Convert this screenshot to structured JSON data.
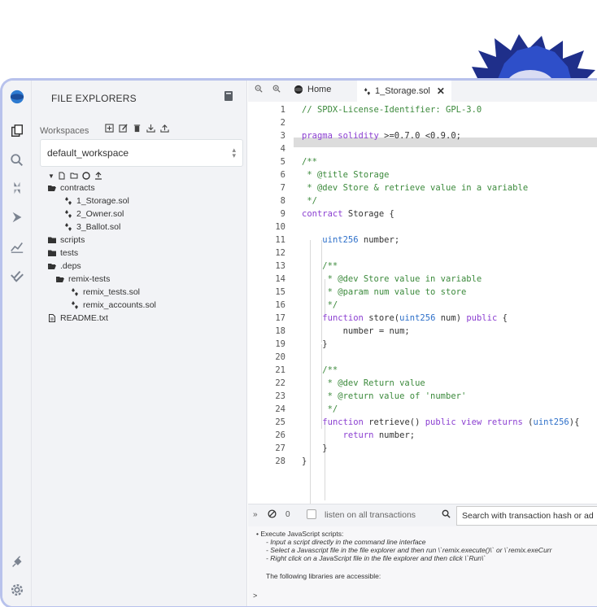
{
  "sidepanel": {
    "title": "FILE EXPLORERS",
    "workspaces_label": "Workspaces",
    "workspace_selected": "default_workspace",
    "tree": [
      {
        "label": "contracts",
        "kind": "folder-open"
      },
      {
        "label": "1_Storage.sol",
        "kind": "sol"
      },
      {
        "label": "2_Owner.sol",
        "kind": "sol"
      },
      {
        "label": "3_Ballot.sol",
        "kind": "sol"
      },
      {
        "label": "scripts",
        "kind": "folder"
      },
      {
        "label": "tests",
        "kind": "folder"
      },
      {
        "label": ".deps",
        "kind": "folder-open"
      },
      {
        "label": "remix-tests",
        "kind": "folder-open"
      },
      {
        "label": "remix_tests.sol",
        "kind": "sol"
      },
      {
        "label": "remix_accounts.sol",
        "kind": "sol"
      },
      {
        "label": "README.txt",
        "kind": "file"
      }
    ]
  },
  "tabs": {
    "home": "Home",
    "active": "1_Storage.sol"
  },
  "editor": {
    "lines": [
      "// SPDX-License-Identifier: GPL-3.0",
      "",
      "pragma solidity >=0.7.0 <0.9.0;",
      "",
      "/**",
      " * @title Storage",
      " * @dev Store & retrieve value in a variable",
      " */",
      "contract Storage {",
      "",
      "    uint256 number;",
      "",
      "    /**",
      "     * @dev Store value in variable",
      "     * @param num value to store",
      "     */",
      "    function store(uint256 num) public {",
      "        number = num;",
      "    }",
      "",
      "    /**",
      "     * @dev Return value",
      "     * @return value of 'number'",
      "     */",
      "    function retrieve() public view returns (uint256){",
      "        return number;",
      "    }",
      "}"
    ]
  },
  "terminal": {
    "count": "0",
    "listen_label": "listen on all transactions",
    "search_placeholder": "Search with transaction hash or ad",
    "lines": [
      "• Execute JavaScript scripts:",
      "- Input a script directly in the command line interface",
      "- Select a Javascript file in the file explorer and then run \\`remix.execute()\\` or \\`remix.exeCurr",
      "- Right click on a JavaScript file in the file explorer and then click \\`Run\\`",
      "The following libraries are accessible:",
      ">"
    ]
  },
  "colors": {
    "frame": "#b8c2ec",
    "keyword": "#8b3fd1",
    "type": "#2d6fc9",
    "comment": "#3c8a3c"
  }
}
